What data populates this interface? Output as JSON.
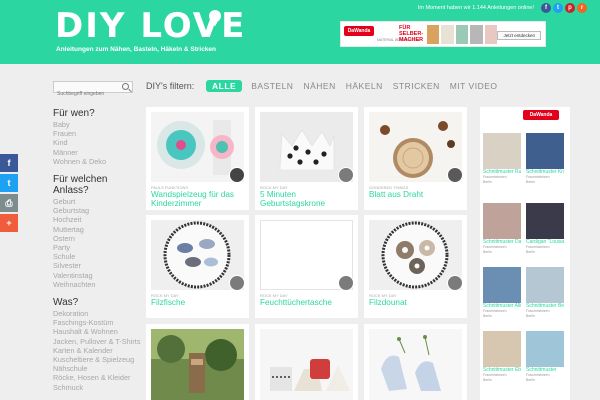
{
  "header": {
    "logo": "DIY LOVE",
    "tagline": "Anleitungen zum Nähen, Basteln, Häkeln & Stricken",
    "subscribers": "Im Moment haben wir 1.144 Anleitungen online!"
  },
  "banner": {
    "brand": "DaWanda",
    "title": "FÜR SELBER-MACHER",
    "subtitle": "MATERIAL BEI DAWANDA",
    "button": "Jetzt entdecken"
  },
  "search": {
    "placeholder": "Suchbegriff eingeben"
  },
  "filter": {
    "label": "DIY's filtern:",
    "options": [
      "ALLE",
      "BASTELN",
      "NÄHEN",
      "HÄKELN",
      "STRICKEN",
      "MIT VIDEO"
    ]
  },
  "sidebar": {
    "groups": [
      {
        "title": "Für wen?",
        "items": [
          "Baby",
          "Frauen",
          "Kind",
          "Männer",
          "Wohnen & Deko"
        ]
      },
      {
        "title": "Für welchen Anlass?",
        "items": [
          "Geburt",
          "Geburtstag",
          "Hochzeit",
          "Muttertag",
          "Ostern",
          "Party",
          "Schule",
          "Silvester",
          "Valentinstag",
          "Weihnachten"
        ]
      },
      {
        "title": "Was?",
        "items": [
          "Dekoration",
          "Faschings-Kostüm",
          "Haushalt & Wohnen",
          "Jacken, Pullover & T-Shirts",
          "Karten & Kalender",
          "Kuscheltiere & Spielzeug",
          "Nähschule",
          "Röcke, Hosen & Kleider",
          "Schmuck"
        ]
      }
    ]
  },
  "cards": [
    {
      "author": "PAULS FUNKTIONS",
      "title": "Wandspielzeug für das Kinderzimmer"
    },
    {
      "author": "ROCK MY DAY",
      "title": "5 Minuten Geburtstagskrone"
    },
    {
      "author": "GONDERED THINGS",
      "title": "Blatt aus Draht"
    },
    {
      "author": "ROCK MY DAY",
      "title": "Filzfische"
    },
    {
      "author": "ROCK MY DAY",
      "title": "Feuchttüchertasche"
    },
    {
      "author": "ROCK MY DAY",
      "title": "Filzdounat"
    }
  ],
  "products": [
    {
      "title": "Schnittmuster Rucksack",
      "shop": "Frauenfabrizen",
      "city": "Berlin"
    },
    {
      "title": "Schnittmuster Krawatte für",
      "shop": "Frauenfabrizen",
      "city": "Berlin"
    },
    {
      "title": "Schnittmuster Damen-Shirt",
      "shop": "Frauenfabrizen",
      "city": "Berlin"
    },
    {
      "title": "Cardigan \"Louisa\" Gr.",
      "shop": "Frauenfabrizen",
      "city": "Berlin"
    },
    {
      "title": "Schnittmuster Allroundtasche",
      "shop": "Frauenfabrizen",
      "city": "Berlin"
    },
    {
      "title": "Schnittmuster Beanie",
      "shop": "Frauenfabrizen",
      "city": "Berlin"
    },
    {
      "title": "Schnittmuster Ebook:",
      "shop": "Frauenfabrizen",
      "city": "Berlin"
    },
    {
      "title": "Schnittmuster",
      "shop": "Frauenfabrizen",
      "city": "Berlin"
    }
  ]
}
